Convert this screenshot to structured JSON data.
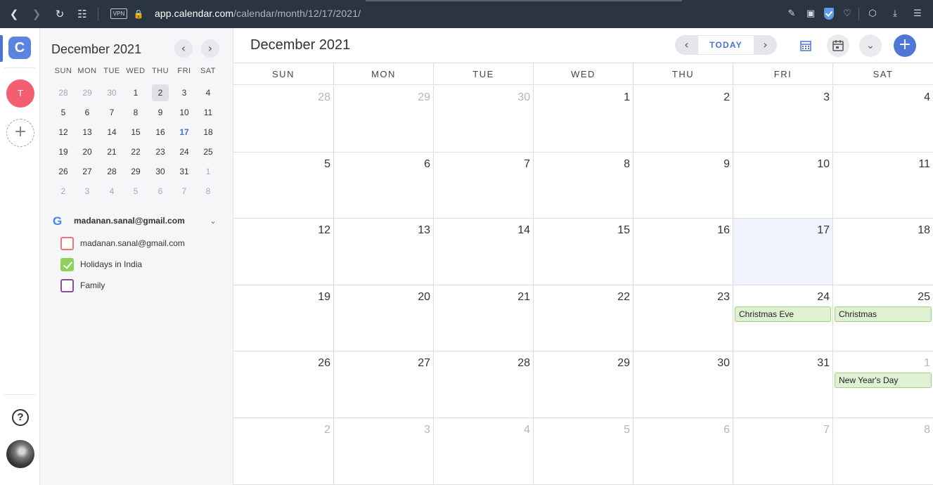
{
  "browser": {
    "vpn_label": "VPN",
    "url_host": "app.calendar.com",
    "url_path": "/calendar/month/12/17/2021/"
  },
  "rail": {
    "logo_letter": "C",
    "avatar_letter": "T",
    "add_symbol": "+",
    "help_symbol": "?"
  },
  "mini_calendar": {
    "title": "December 2021",
    "prev_symbol": "‹",
    "next_symbol": "›",
    "weekdays": [
      "SUN",
      "MON",
      "TUE",
      "WED",
      "THU",
      "FRI",
      "SAT"
    ],
    "weeks": [
      [
        "28",
        "29",
        "30",
        "1",
        "2",
        "3",
        "4"
      ],
      [
        "5",
        "6",
        "7",
        "8",
        "9",
        "10",
        "11"
      ],
      [
        "12",
        "13",
        "14",
        "15",
        "16",
        "17",
        "18"
      ],
      [
        "19",
        "20",
        "21",
        "22",
        "23",
        "24",
        "25"
      ],
      [
        "26",
        "27",
        "28",
        "29",
        "30",
        "31",
        "1"
      ],
      [
        "2",
        "3",
        "4",
        "5",
        "6",
        "7",
        "8"
      ]
    ]
  },
  "accounts": {
    "google_letter": "G",
    "email": "madanan.sanal@gmail.com",
    "calendars": [
      {
        "label": "madanan.sanal@gmail.com",
        "color": "#f0737e",
        "checked": false
      },
      {
        "label": "Holidays in India",
        "color": "#8ed25c",
        "checked": true
      },
      {
        "label": "Family",
        "color": "#8b4e96",
        "checked": false
      }
    ]
  },
  "main": {
    "title": "December 2021",
    "today_label": "TODAY",
    "prev_symbol": "‹",
    "next_symbol": "›",
    "add_symbol": "+",
    "weekday_headers": [
      "SUN",
      "MON",
      "TUE",
      "WED",
      "THU",
      "FRI",
      "SAT"
    ],
    "weeks": [
      [
        "28",
        "29",
        "30",
        "1",
        "2",
        "3",
        "4"
      ],
      [
        "5",
        "6",
        "7",
        "8",
        "9",
        "10",
        "11"
      ],
      [
        "12",
        "13",
        "14",
        "15",
        "16",
        "17",
        "18"
      ],
      [
        "19",
        "20",
        "21",
        "22",
        "23",
        "24",
        "25"
      ],
      [
        "26",
        "27",
        "28",
        "29",
        "30",
        "31",
        "1"
      ],
      [
        "2",
        "3",
        "4",
        "5",
        "6",
        "7",
        "8"
      ]
    ],
    "events": [
      {
        "week": 3,
        "day": 5,
        "title": "Christmas Eve"
      },
      {
        "week": 3,
        "day": 6,
        "title": "Christmas"
      },
      {
        "week": 4,
        "day": 6,
        "title": "New Year's Day"
      }
    ]
  },
  "colors": {
    "accent": "#4a73d1",
    "today_cell_bg": "#eef3fd",
    "holiday_event_bg": "#dff1d2",
    "holiday_event_border": "#9bd57a"
  }
}
